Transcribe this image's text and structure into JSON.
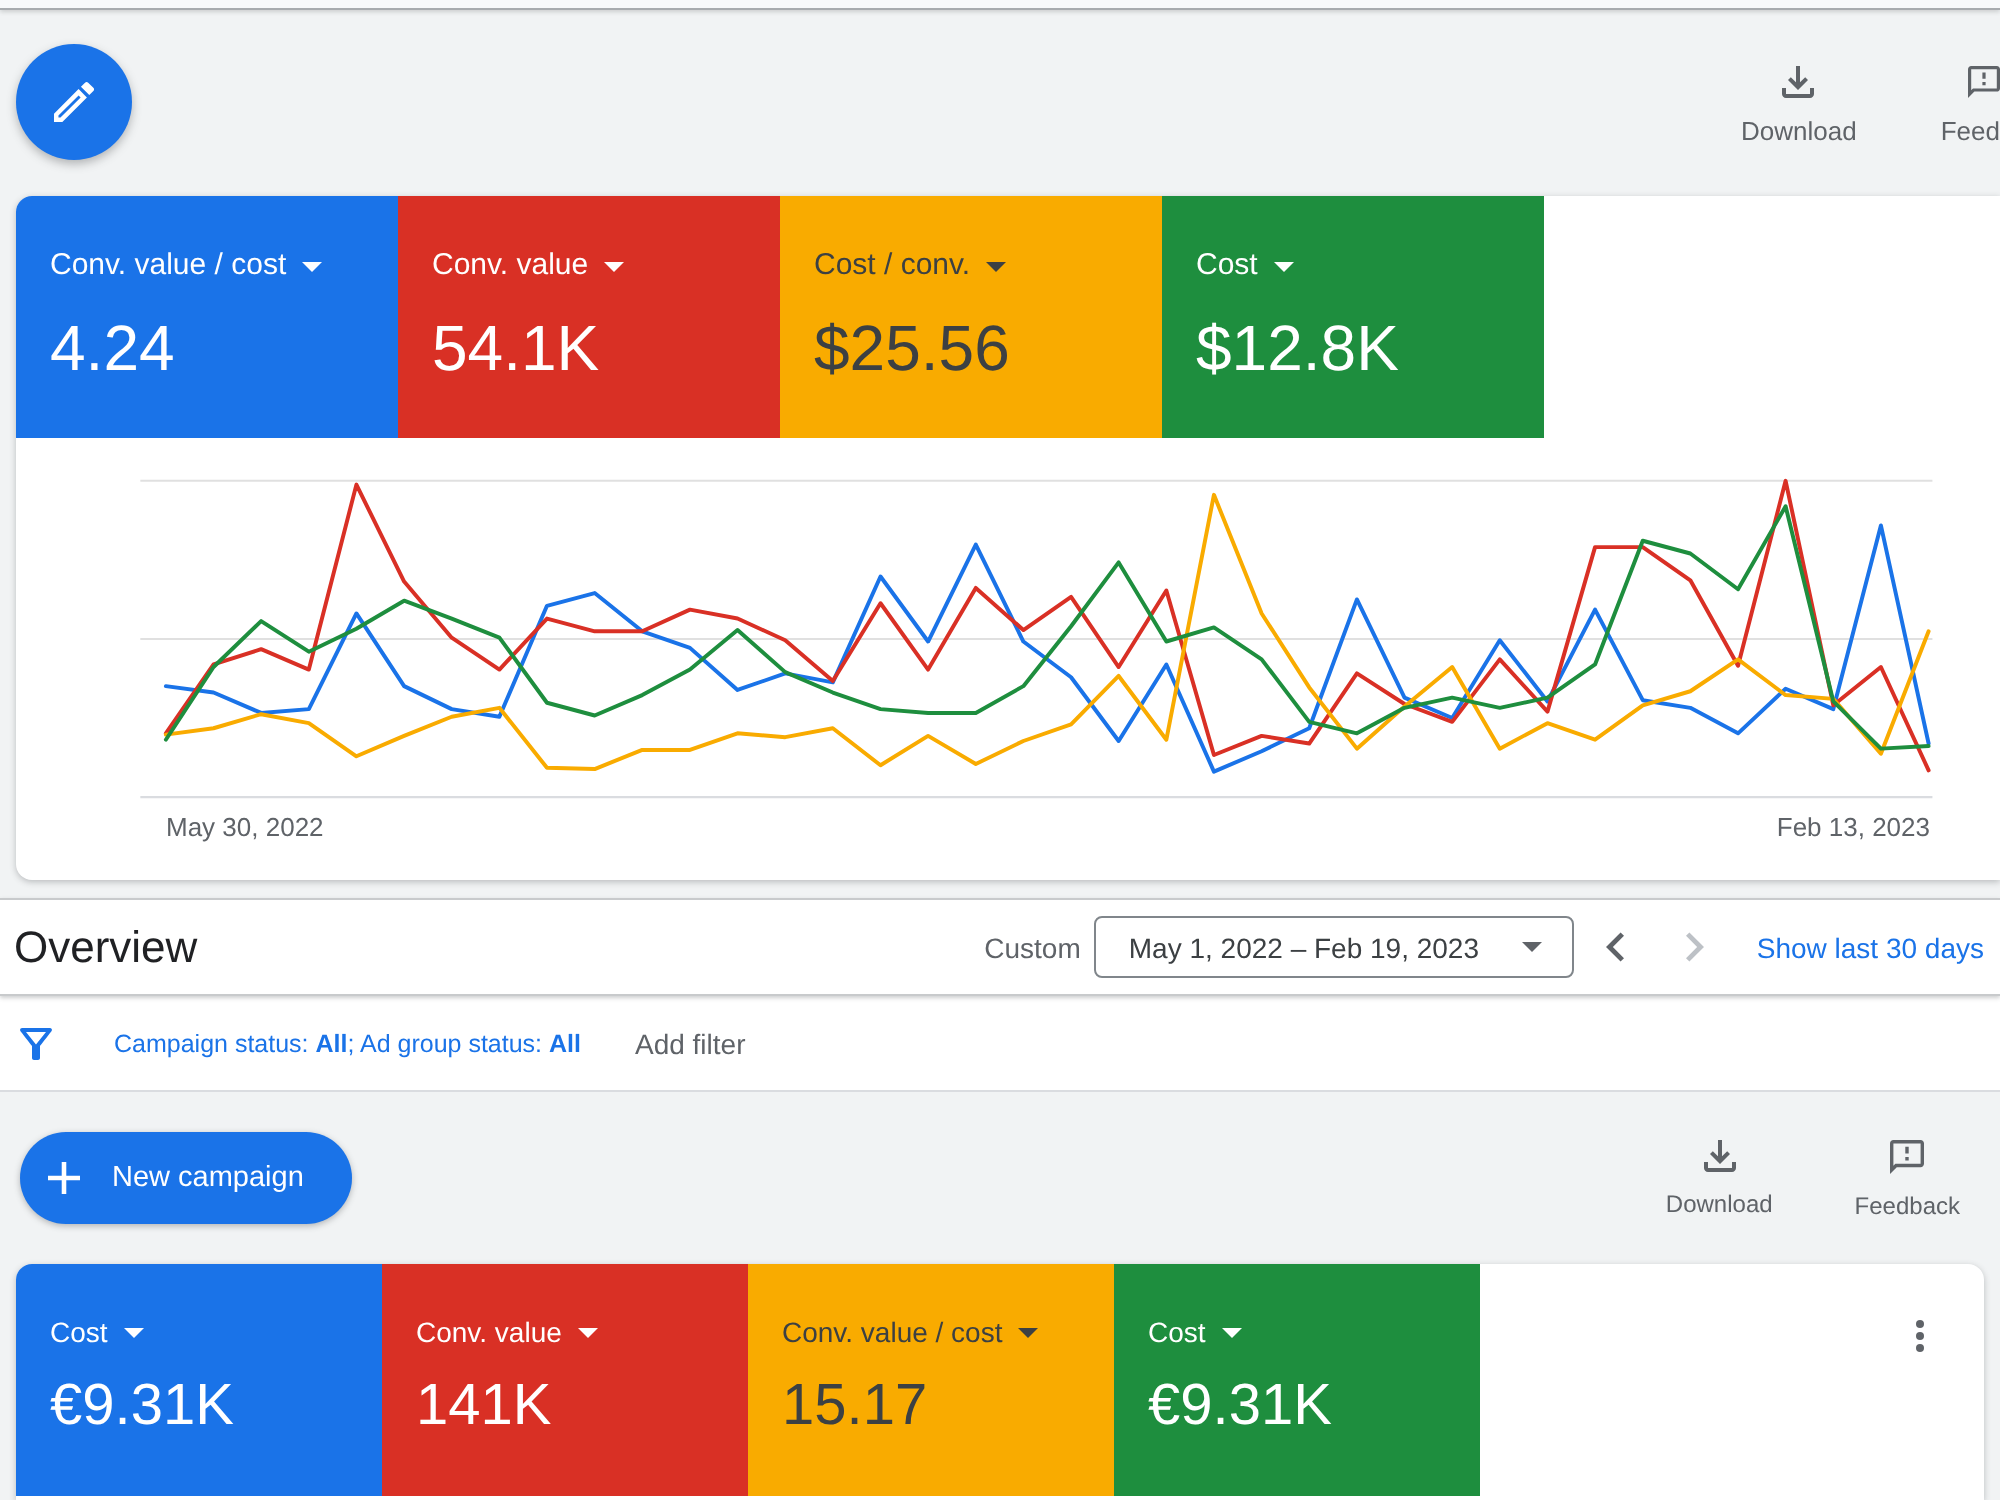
{
  "toolbar": {
    "actions": [
      {
        "kind": "download",
        "label": "Download"
      },
      {
        "kind": "feedback",
        "label": "Feed"
      }
    ]
  },
  "scorecard": {
    "tiles": [
      {
        "label": "Conv. value / cost",
        "value": "4.24",
        "color": "#1a73e8"
      },
      {
        "label": "Conv. value",
        "value": "54.1K",
        "color": "#d93025"
      },
      {
        "label": "Cost / conv.",
        "value": "$25.56",
        "color": "#f9ab00"
      },
      {
        "label": "Cost",
        "value": "$12.8K",
        "color": "#1e8e3e"
      }
    ],
    "chart": {
      "x_labels": [
        "May 30, 2022",
        "Feb 13, 2023"
      ]
    }
  },
  "overview": {
    "title": "Overview",
    "range_label": "Custom",
    "date_range": "May 1, 2022 – Feb 19, 2023",
    "pager": [
      {
        "kind": "previous",
        "disabled": false
      },
      {
        "kind": "next",
        "disabled": true
      }
    ],
    "shortcut_link": "Show last 30 days"
  },
  "filter_bar": {
    "summary": "Campaign status: **All**; Ad group status: **All**",
    "add_filter": "Add filter"
  },
  "campaigns": {
    "new_button": "New campaign",
    "actions": [
      {
        "kind": "download",
        "label": "Download"
      },
      {
        "kind": "feedback",
        "label": "Feedback"
      }
    ],
    "tiles": [
      {
        "label": "Cost",
        "value": "€9.31K",
        "color": "#1a73e8"
      },
      {
        "label": "Conv. value",
        "value": "141K",
        "color": "#d93025"
      },
      {
        "label": "Conv. value / cost",
        "value": "15.17",
        "color": "#f9ab00"
      },
      {
        "label": "Cost",
        "value": "€9.31K",
        "color": "#1e8e3e"
      }
    ]
  }
}
